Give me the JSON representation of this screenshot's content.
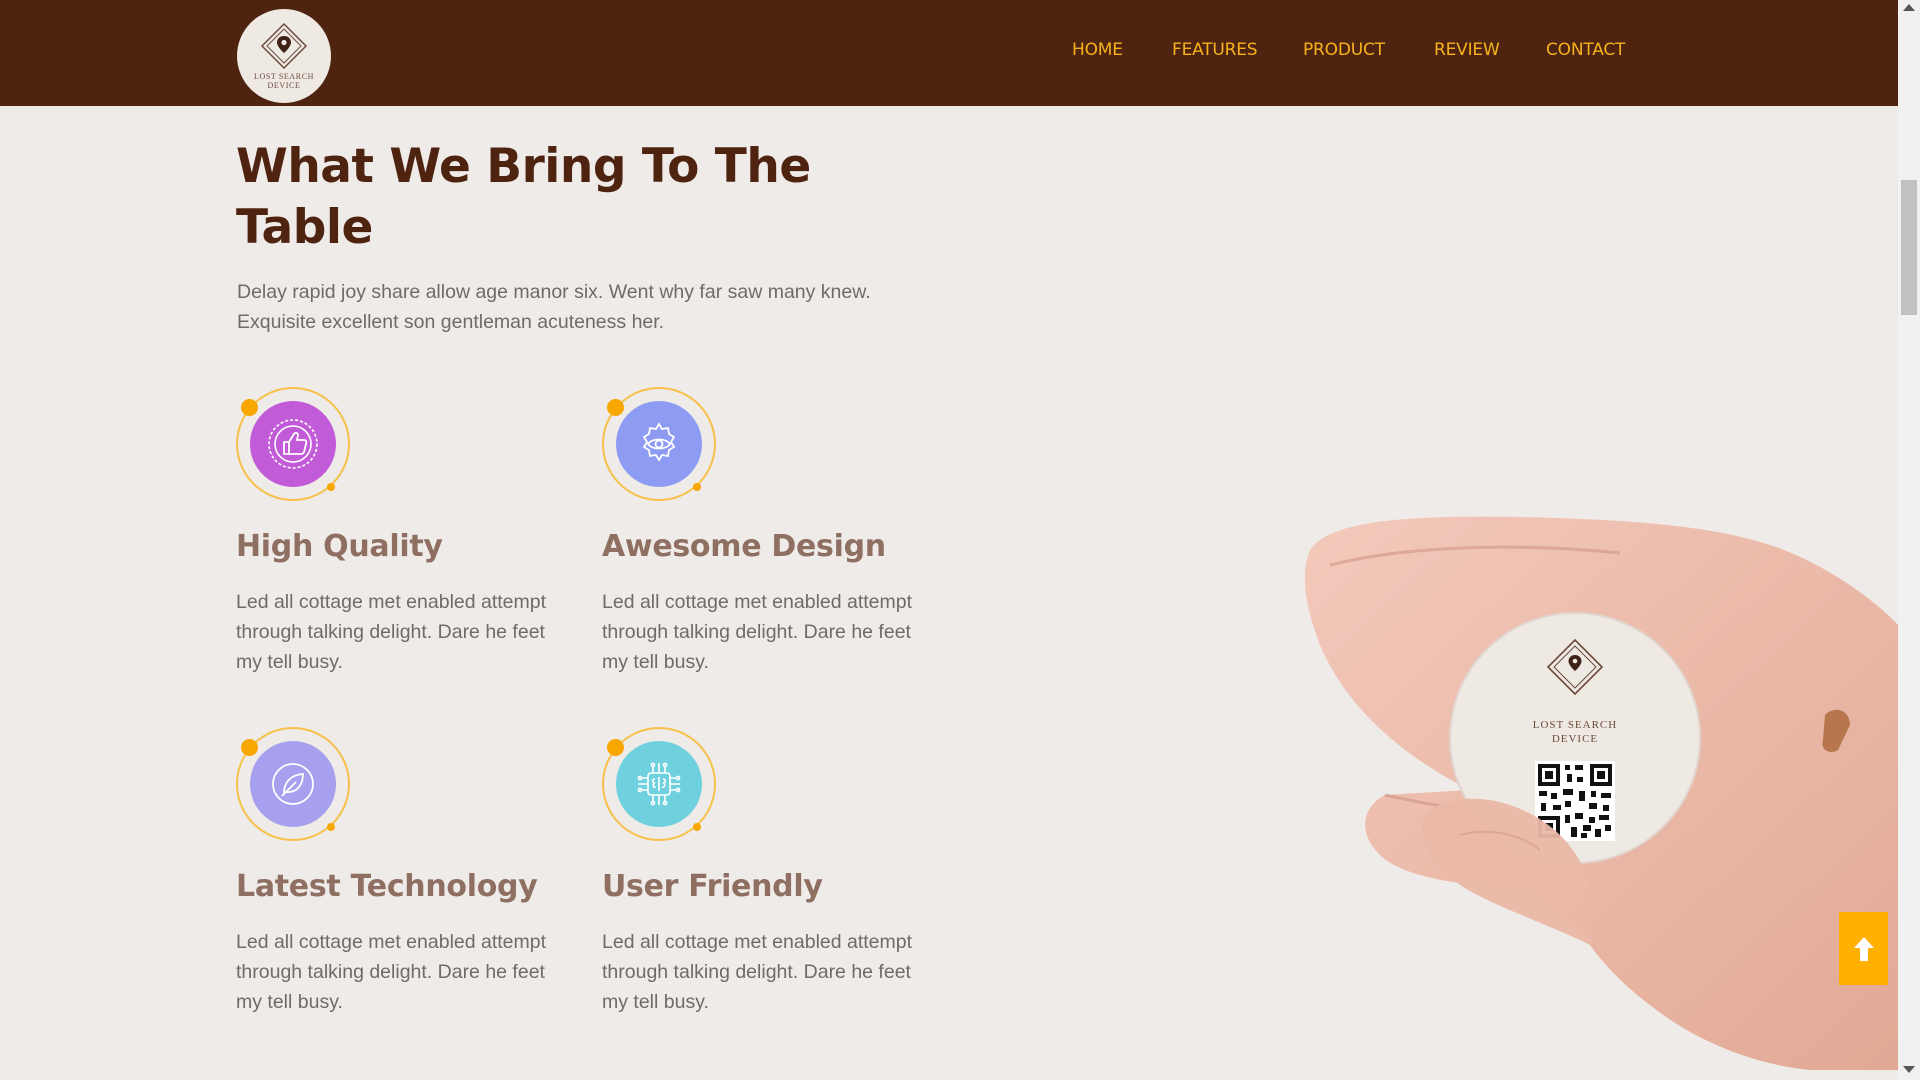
{
  "header": {
    "logo_text": "LOST SEARCH DEVICE",
    "background_color": "#4e2410",
    "nav": [
      {
        "label": "HOME"
      },
      {
        "label": "FEATURES"
      },
      {
        "label": "PRODUCT"
      },
      {
        "label": "REVIEW"
      },
      {
        "label": "CONTACT"
      }
    ],
    "nav_color": "#f5b21b"
  },
  "section": {
    "title": "What We Bring To The Table",
    "intro": "Delay rapid joy share allow age manor six. Went why far saw many knew. Exquisite excellent son gentleman acuteness her.",
    "features": [
      {
        "icon": "thumbs-up-icon",
        "color": "#c25bd8",
        "title": "High Quality",
        "text": "Led all cottage met enabled attempt through talking delight. Dare he feet my tell busy."
      },
      {
        "icon": "gear-eye-icon",
        "color": "#8d9bf3",
        "title": "Awesome Design",
        "text": "Led all cottage met enabled attempt through talking delight. Dare he feet my tell busy."
      },
      {
        "icon": "leaf-icon",
        "color": "#a6a0ee",
        "title": "Latest Technology",
        "text": "Led all cottage met enabled attempt through talking delight. Dare he feet my tell busy."
      },
      {
        "icon": "circuit-brain-icon",
        "color": "#6fd0de",
        "title": "User Friendly",
        "text": "Led all cottage met enabled attempt through talking delight. Dare he feet my tell busy."
      }
    ]
  },
  "product_image": {
    "device_text": "LOST SEARCH DEVICE"
  },
  "scroll_top": {
    "icon": "arrow-up-icon",
    "color": "#ffb000"
  }
}
